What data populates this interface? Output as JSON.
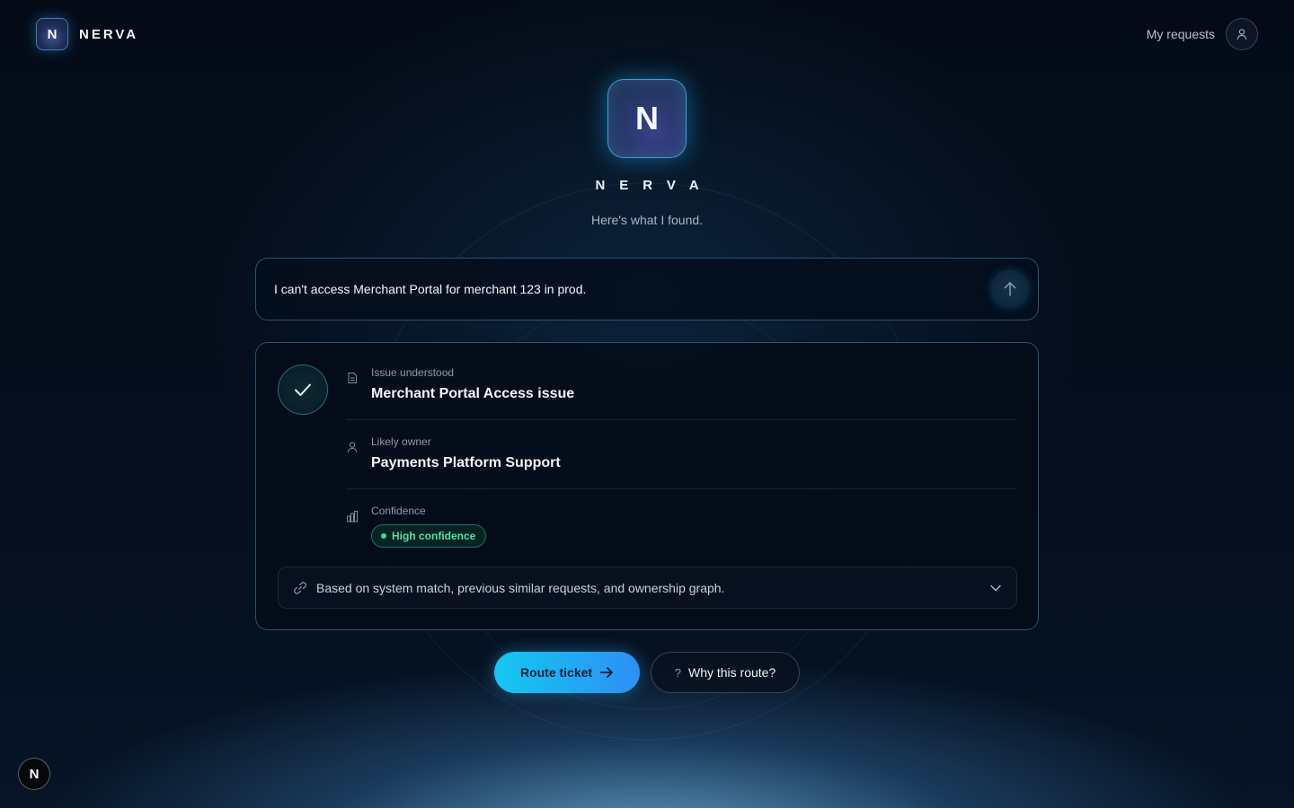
{
  "header": {
    "brand_letter": "N",
    "brand_name": "NERVA",
    "account_link": "My requests",
    "avatar_icon": "user-icon"
  },
  "hero": {
    "logo_letter": "N",
    "name": "NERVA",
    "subtitle": "Here's what I found."
  },
  "query": {
    "text": "I can't access Merchant Portal for merchant 123 in prod.",
    "send_icon": "arrow-up-icon"
  },
  "result": {
    "status_icon": "check-icon",
    "rows": [
      {
        "icon": "document-icon",
        "label": "Issue understood",
        "value": "Merchant Portal Access issue"
      },
      {
        "icon": "user-icon",
        "label": "Likely owner",
        "value": "Payments Platform Support"
      },
      {
        "icon": "bar-chart-icon",
        "label": "Confidence",
        "badge": "High confidence"
      }
    ],
    "reason": "Based on system match, previous similar requests, and ownership graph.",
    "reason_icon": "link-icon",
    "expand_icon": "chevron-down-icon"
  },
  "actions": {
    "primary": "Route ticket",
    "primary_icon": "arrow-right-icon",
    "secondary_glyph": "?",
    "secondary": "Why this route?"
  },
  "corner_badge": "N",
  "colors": {
    "accent_start": "#14c8f0",
    "accent_end": "#2d8ff5",
    "success": "#52e0a4",
    "background": "#040b17"
  }
}
